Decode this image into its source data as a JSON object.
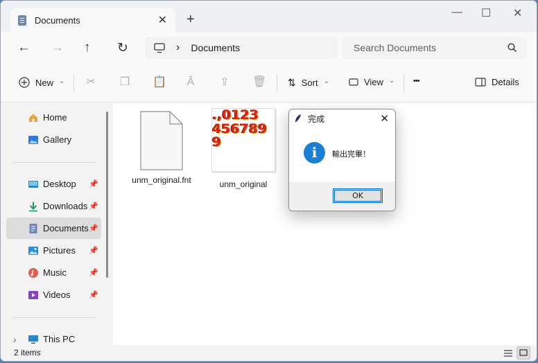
{
  "tab": {
    "title": "Documents",
    "close": "✕",
    "new_tab": "+"
  },
  "window_controls": {
    "minimize": "—",
    "maximize": "☐",
    "close": "✕"
  },
  "nav": {
    "back": "←",
    "forward": "→",
    "up": "↑",
    "refresh": "↻",
    "path_sep": "›",
    "location": "Documents"
  },
  "search": {
    "placeholder": "Search Documents"
  },
  "toolbar": {
    "new": "New",
    "sort": "Sort",
    "view": "View",
    "more": "•••",
    "details": "Details",
    "chevron": "⌄"
  },
  "sidebar": {
    "items": [
      {
        "label": "Home"
      },
      {
        "label": "Gallery"
      },
      {
        "label": "Desktop"
      },
      {
        "label": "Downloads"
      },
      {
        "label": "Documents"
      },
      {
        "label": "Pictures"
      },
      {
        "label": "Music"
      },
      {
        "label": "Videos"
      },
      {
        "label": "This PC"
      }
    ],
    "pin": "📌",
    "expand": "›"
  },
  "files": [
    {
      "name": "unm_original.fnt",
      "icon": "document-icon"
    },
    {
      "name": "unm_original",
      "icon": "image-thumbnail",
      "thumb_lines": [
        ".,0123",
        "456789",
        "9"
      ]
    }
  ],
  "status": {
    "count": "2 items"
  },
  "dialog": {
    "title": "完成",
    "close": "✕",
    "message": "輸出完畢！",
    "info_glyph": "i",
    "ok": "OK"
  },
  "colors": {
    "accent": "#0078d4",
    "thumb_red": "#d8241a",
    "thumb_gold": "#f2b233"
  }
}
